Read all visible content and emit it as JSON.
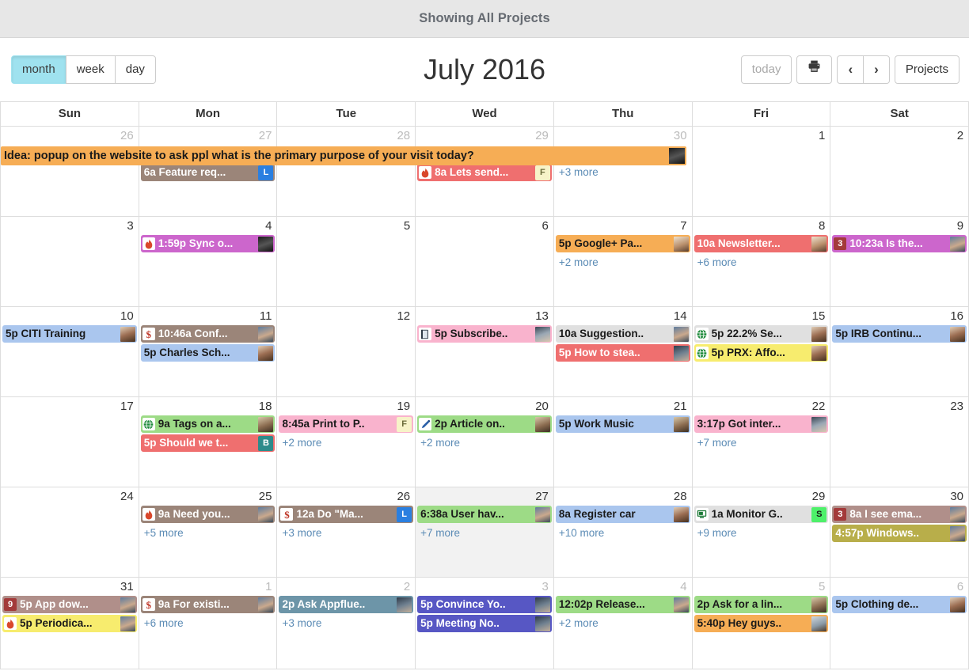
{
  "banner": {
    "title": "Showing All Projects"
  },
  "toolbar": {
    "views": [
      {
        "label": "month",
        "active": true
      },
      {
        "label": "week",
        "active": false
      },
      {
        "label": "day",
        "active": false
      }
    ],
    "title": "July 2016",
    "today_label": "today",
    "print_icon": "printer-icon",
    "prev_label": "‹",
    "next_label": "›",
    "projects_label": "Projects"
  },
  "calendar": {
    "day_headers": [
      "Sun",
      "Mon",
      "Tue",
      "Wed",
      "Thu",
      "Fri",
      "Sat"
    ],
    "spanning_event": {
      "text": "Idea: popup on the website to ask ppl what is the primary purpose of your visit today?",
      "bg": "#f6ad55",
      "color": "#1a1a1a",
      "avatar": "face-dark"
    },
    "weeks": [
      {
        "days": [
          {
            "num": "26",
            "other": true,
            "events": [],
            "more": ""
          },
          {
            "num": "27",
            "other": true,
            "events": [
              {
                "time": "6a",
                "title": "Feature req...",
                "icon": "",
                "bg": "#9b8579",
                "color": "#ffffff",
                "avatar": "",
                "tag": "L",
                "tag_bg": "#2a7fe0"
              }
            ],
            "more": ""
          },
          {
            "num": "28",
            "other": true,
            "events": [],
            "more": ""
          },
          {
            "num": "29",
            "other": true,
            "events": [
              {
                "time": "8a",
                "title": "Lets send...",
                "icon": "flame-icon",
                "bg": "#ef6f6f",
                "color": "#ffffff",
                "avatar": "",
                "tag": "F",
                "tag_bg": "#f7f3c8",
                "tag_color": "#6b6b3a"
              }
            ],
            "more": ""
          },
          {
            "num": "30",
            "other": true,
            "events": [],
            "more": "+3 more"
          },
          {
            "num": "1",
            "other": false,
            "events": [],
            "more": ""
          },
          {
            "num": "2",
            "other": false,
            "events": [],
            "more": ""
          }
        ]
      },
      {
        "days": [
          {
            "num": "3",
            "other": false,
            "events": [],
            "more": ""
          },
          {
            "num": "4",
            "other": false,
            "events": [
              {
                "time": "1:59p",
                "title": "Sync o...",
                "icon": "flame-icon",
                "bg": "#cc66cc",
                "color": "#ffffff",
                "avatar": "face-dark",
                "tag": ""
              }
            ],
            "more": ""
          },
          {
            "num": "5",
            "other": false,
            "events": [],
            "more": ""
          },
          {
            "num": "6",
            "other": false,
            "events": [],
            "more": ""
          },
          {
            "num": "7",
            "other": false,
            "events": [
              {
                "time": "5p",
                "title": "Google+ Pa...",
                "icon": "",
                "bg": "#f6ad55",
                "color": "#1a1a1a",
                "avatar": "face-f",
                "tag": ""
              }
            ],
            "more": "+2 more"
          },
          {
            "num": "8",
            "other": false,
            "events": [
              {
                "time": "10a",
                "title": "Newsletter...",
                "icon": "",
                "bg": "#ef6f6f",
                "color": "#ffffff",
                "avatar": "face-f",
                "tag": ""
              }
            ],
            "more": "+6 more"
          },
          {
            "num": "9",
            "other": false,
            "events": [
              {
                "time": "10:23a",
                "title": "Is the...",
                "icon": "3-badge-icon",
                "bg": "#cc66cc",
                "color": "#ffffff",
                "avatar": "face-c",
                "tag": ""
              }
            ],
            "more": ""
          }
        ]
      },
      {
        "days": [
          {
            "num": "10",
            "other": false,
            "events": [
              {
                "time": "5p",
                "title": "CITI Training",
                "icon": "",
                "bg": "#aac6ee",
                "color": "#1a1a1a",
                "avatar": "face-d",
                "tag": ""
              }
            ],
            "more": ""
          },
          {
            "num": "11",
            "other": false,
            "events": [
              {
                "time": "10:46a",
                "title": "Conf...",
                "icon": "dollar-icon",
                "bg": "#9b8579",
                "color": "#ffffff",
                "avatar": "face-c",
                "tag": ""
              },
              {
                "time": "5p",
                "title": "Charles Sch...",
                "icon": "",
                "bg": "#aac6ee",
                "color": "#1a1a1a",
                "avatar": "face-d",
                "tag": ""
              }
            ],
            "more": ""
          },
          {
            "num": "12",
            "other": false,
            "events": [],
            "more": ""
          },
          {
            "num": "13",
            "other": false,
            "events": [
              {
                "time": "5p",
                "title": "Subscribe..",
                "icon": "book-icon",
                "bg": "#f9b3cd",
                "color": "#1a1a1a",
                "avatar": "face-e",
                "tag": ""
              }
            ],
            "more": ""
          },
          {
            "num": "14",
            "other": false,
            "events": [
              {
                "time": "10a",
                "title": "Suggestion..",
                "icon": "",
                "bg": "#e0e0e0",
                "color": "#1a1a1a",
                "avatar": "face-c",
                "tag": ""
              },
              {
                "time": "5p",
                "title": "How to stea..",
                "icon": "",
                "bg": "#ef6f6f",
                "color": "#ffffff",
                "avatar": "face-g",
                "tag": ""
              }
            ],
            "more": ""
          },
          {
            "num": "15",
            "other": false,
            "events": [
              {
                "time": "5p",
                "title": "22.2% Se...",
                "icon": "globe-icon",
                "bg": "#e0e0e0",
                "color": "#1a1a1a",
                "avatar": "face-d",
                "tag": ""
              },
              {
                "time": "5p",
                "title": "PRX: Affo...",
                "icon": "globe-icon",
                "bg": "#f7ec6e",
                "color": "#1a1a1a",
                "avatar": "face-d",
                "tag": ""
              }
            ],
            "more": ""
          },
          {
            "num": "16",
            "other": false,
            "events": [
              {
                "time": "5p",
                "title": "IRB Continu...",
                "icon": "",
                "bg": "#aac6ee",
                "color": "#1a1a1a",
                "avatar": "face-d",
                "tag": ""
              }
            ],
            "more": ""
          }
        ]
      },
      {
        "days": [
          {
            "num": "17",
            "other": false,
            "events": [],
            "more": ""
          },
          {
            "num": "18",
            "other": false,
            "events": [
              {
                "time": "9a",
                "title": "Tags on a...",
                "icon": "globe-icon",
                "bg": "#9ddb86",
                "color": "#1a1a1a",
                "avatar": "face-b",
                "tag": ""
              },
              {
                "time": "5p",
                "title": "Should we t...",
                "icon": "",
                "bg": "#ef6f6f",
                "color": "#ffffff",
                "avatar": "",
                "tag": "B",
                "tag_bg": "#2d8b8b"
              }
            ],
            "more": ""
          },
          {
            "num": "19",
            "other": false,
            "events": [
              {
                "time": "8:45a",
                "title": "Print to P..",
                "icon": "",
                "bg": "#f9b3cd",
                "color": "#1a1a1a",
                "avatar": "",
                "tag": "F",
                "tag_bg": "#f7f3c8",
                "tag_color": "#6b6b3a"
              }
            ],
            "more": "+2 more"
          },
          {
            "num": "20",
            "other": false,
            "events": [
              {
                "time": "2p",
                "title": "Article on..",
                "icon": "pencil-icon",
                "bg": "#9ddb86",
                "color": "#1a1a1a",
                "avatar": "face-b",
                "tag": ""
              }
            ],
            "more": "+2 more"
          },
          {
            "num": "21",
            "other": false,
            "events": [
              {
                "time": "5p",
                "title": "Work Music",
                "icon": "",
                "bg": "#aac6ee",
                "color": "#1a1a1a",
                "avatar": "face-b",
                "tag": ""
              }
            ],
            "more": ""
          },
          {
            "num": "22",
            "other": false,
            "events": [
              {
                "time": "3:17p",
                "title": "Got inter...",
                "icon": "",
                "bg": "#f9b3cd",
                "color": "#1a1a1a",
                "avatar": "face-e",
                "tag": ""
              }
            ],
            "more": "+7 more"
          },
          {
            "num": "23",
            "other": false,
            "events": [],
            "more": ""
          }
        ]
      },
      {
        "days": [
          {
            "num": "24",
            "other": false,
            "events": [],
            "more": ""
          },
          {
            "num": "25",
            "other": false,
            "events": [
              {
                "time": "9a",
                "title": "Need you...",
                "icon": "flame-icon",
                "bg": "#9b8579",
                "color": "#ffffff",
                "avatar": "face-c",
                "tag": ""
              }
            ],
            "more": "+5 more"
          },
          {
            "num": "26",
            "other": false,
            "events": [
              {
                "time": "12a",
                "title": "Do \"Ma...",
                "icon": "dollar-icon",
                "bg": "#9b8579",
                "color": "#ffffff",
                "avatar": "",
                "tag": "L",
                "tag_bg": "#2a7fe0"
              }
            ],
            "more": "+3 more"
          },
          {
            "num": "27",
            "other": false,
            "today": true,
            "events": [
              {
                "time": "6:38a",
                "title": "User hav...",
                "icon": "",
                "bg": "#9ddb86",
                "color": "#1a1a1a",
                "avatar": "face-c",
                "tag": ""
              }
            ],
            "more": "+7 more"
          },
          {
            "num": "28",
            "other": false,
            "events": [
              {
                "time": "8a",
                "title": "Register car",
                "icon": "",
                "bg": "#aac6ee",
                "color": "#1a1a1a",
                "avatar": "face-d",
                "tag": ""
              }
            ],
            "more": "+10 more"
          },
          {
            "num": "29",
            "other": false,
            "events": [
              {
                "time": "1a",
                "title": "Monitor G..",
                "icon": "monitor-icon",
                "bg": "#e0e0e0",
                "color": "#1a1a1a",
                "avatar": "",
                "tag": "S",
                "tag_bg": "#4ef06a",
                "tag_color": "#1a1a1a"
              }
            ],
            "more": "+9 more"
          },
          {
            "num": "30",
            "other": false,
            "events": [
              {
                "time": "8a",
                "title": "I see ema...",
                "icon": "3-badge-icon",
                "bg": "#b08f8a",
                "color": "#ffffff",
                "avatar": "face-c",
                "tag": ""
              },
              {
                "time": "4:57p",
                "title": "Windows..",
                "icon": "",
                "bg": "#b8ae4a",
                "color": "#ffffff",
                "avatar": "face-c",
                "tag": ""
              }
            ],
            "more": ""
          }
        ]
      },
      {
        "days": [
          {
            "num": "31",
            "other": false,
            "events": [
              {
                "time": "5p",
                "title": "App dow...",
                "icon": "9-badge-icon",
                "bg": "#b08f8a",
                "color": "#ffffff",
                "avatar": "face-c",
                "tag": ""
              },
              {
                "time": "5p",
                "title": "Periodica...",
                "icon": "flame-icon",
                "bg": "#f7ec6e",
                "color": "#1a1a1a",
                "avatar": "face-c",
                "tag": ""
              }
            ],
            "more": ""
          },
          {
            "num": "1",
            "other": true,
            "events": [
              {
                "time": "9a",
                "title": "For existi...",
                "icon": "dollar-icon",
                "bg": "#9b8579",
                "color": "#ffffff",
                "avatar": "face-c",
                "tag": ""
              }
            ],
            "more": "+6 more"
          },
          {
            "num": "2",
            "other": true,
            "events": [
              {
                "time": "2p",
                "title": "Ask Appflue..",
                "icon": "",
                "bg": "#6d95a8",
                "color": "#ffffff",
                "avatar": "face-g",
                "tag": ""
              }
            ],
            "more": "+3 more"
          },
          {
            "num": "3",
            "other": true,
            "events": [
              {
                "time": "5p",
                "title": "Convince Yo..",
                "icon": "",
                "bg": "#5757c4",
                "color": "#ffffff",
                "avatar": "face-g",
                "tag": ""
              },
              {
                "time": "5p",
                "title": "Meeting No..",
                "icon": "",
                "bg": "#5757c4",
                "color": "#ffffff",
                "avatar": "face-g",
                "tag": ""
              }
            ],
            "more": ""
          },
          {
            "num": "4",
            "other": true,
            "events": [
              {
                "time": "12:02p",
                "title": "Release...",
                "icon": "",
                "bg": "#9ddb86",
                "color": "#1a1a1a",
                "avatar": "face-c",
                "tag": ""
              }
            ],
            "more": "+2 more"
          },
          {
            "num": "5",
            "other": true,
            "events": [
              {
                "time": "2p",
                "title": "Ask for a lin...",
                "icon": "",
                "bg": "#9ddb86",
                "color": "#1a1a1a",
                "avatar": "face-b",
                "tag": ""
              },
              {
                "time": "5:40p",
                "title": "Hey guys..",
                "icon": "",
                "bg": "#f6ad55",
                "color": "#1a1a1a",
                "avatar": "face-h",
                "tag": ""
              }
            ],
            "more": ""
          },
          {
            "num": "6",
            "other": true,
            "events": [
              {
                "time": "5p",
                "title": "Clothing de...",
                "icon": "",
                "bg": "#aac6ee",
                "color": "#1a1a1a",
                "avatar": "face-d",
                "tag": ""
              }
            ],
            "more": ""
          }
        ]
      }
    ]
  }
}
